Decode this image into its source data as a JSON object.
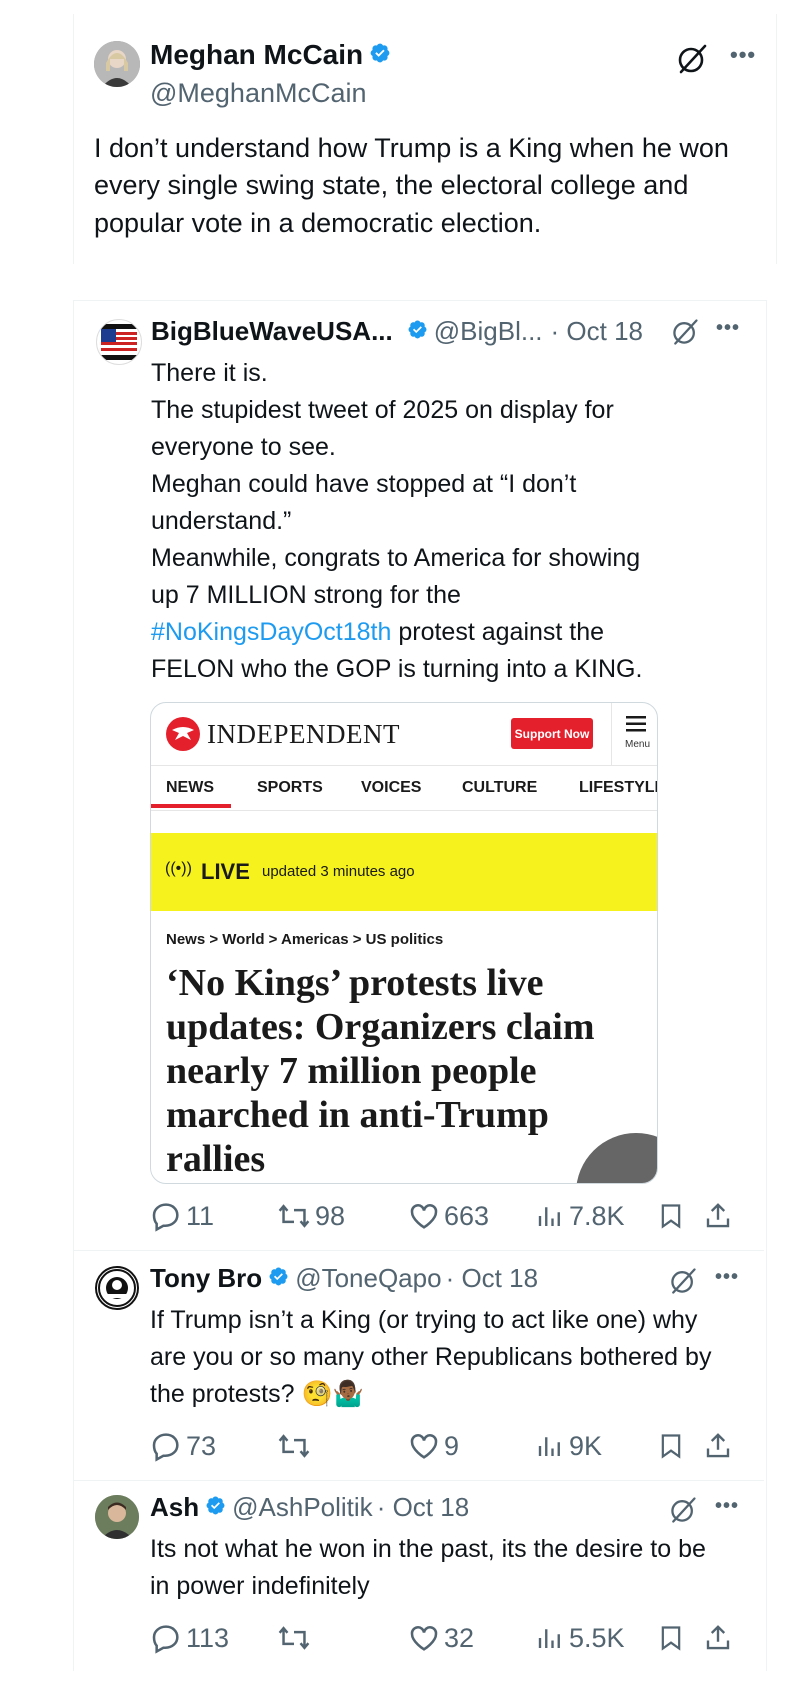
{
  "main_post": {
    "name": "Meghan McCain",
    "handle": "@MeghanMcCain",
    "text": "I don’t understand how Trump is a King when he won every single swing state, the electoral college and popular vote in a democratic election."
  },
  "quote_post": {
    "name": "BigBlueWaveUSA...",
    "handle": "@BigBl...",
    "date": "· Oct 18",
    "lines": [
      "There it is.",
      "The stupidest tweet of 2025 on display for",
      "everyone to see.",
      "Meghan could have stopped at “I don’t",
      "understand.”",
      "Meanwhile, congrats to America for showing",
      "up 7 MILLION strong for the"
    ],
    "hashtag": "#NoKingsDayOct18th",
    "after_hashtag": " protest against the",
    "last_line": "FELON who the GOP is turning into a KING.",
    "embed": {
      "logo": "INDEPENDENT",
      "support": "Support Now",
      "menu": "Menu",
      "nav": [
        "NEWS",
        "SPORTS",
        "VOICES",
        "CULTURE",
        "LIFESTYLE"
      ],
      "live": "LIVE",
      "updated": "updated  3 minutes ago",
      "breadcrumb": "News > World > Americas > US politics",
      "headline": "‘No Kings’ protests live updates: Organizers claim nearly 7 million people marched in anti-Trump rallies"
    },
    "stats": {
      "replies": "11",
      "reposts": "98",
      "likes": "663",
      "views": "7.8K"
    }
  },
  "replies": [
    {
      "name": "Tony Bro",
      "handle": "@ToneQapo",
      "date": "· Oct 18",
      "text": "If Trump isn’t a King (or trying to act like one) why are you or so many other Republicans bothered by the protests? 🧐🤷🏾‍♂️",
      "stats": {
        "replies": "73",
        "reposts": "",
        "likes": "9",
        "views": "9K"
      }
    },
    {
      "name": "Ash",
      "handle": "@AshPolitik",
      "date": "· Oct 18",
      "text": "Its not what he won in the past, its the desire to be in power indefinitely",
      "stats": {
        "replies": "113",
        "reposts": "",
        "likes": "32",
        "views": "5.5K"
      }
    }
  ],
  "colors": {
    "verified": "#1d9bf0",
    "hashtag": "#1d9bf0",
    "muted": "#536471"
  }
}
